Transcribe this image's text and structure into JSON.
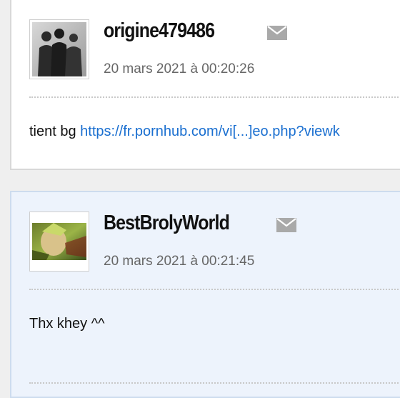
{
  "posts": [
    {
      "username": "origine479486",
      "date": "20 mars 2021 à 00:20:26",
      "avatar_icon": "avatar-silhouettes",
      "message_text": "tient bg ",
      "message_link": "https://fr.pornhub.com/vi[...]eo.php?viewk"
    },
    {
      "username": "BestBrolyWorld",
      "date": "20 mars 2021 à 00:21:45",
      "avatar_icon": "avatar-broly",
      "message_text": "Thx khey ^^"
    }
  ],
  "colors": {
    "page_bg": "#efefef",
    "post_bg": "#ffffff",
    "highlight_post_bg": "#edf3fc",
    "link": "#1a6fd0",
    "date": "#666666"
  }
}
